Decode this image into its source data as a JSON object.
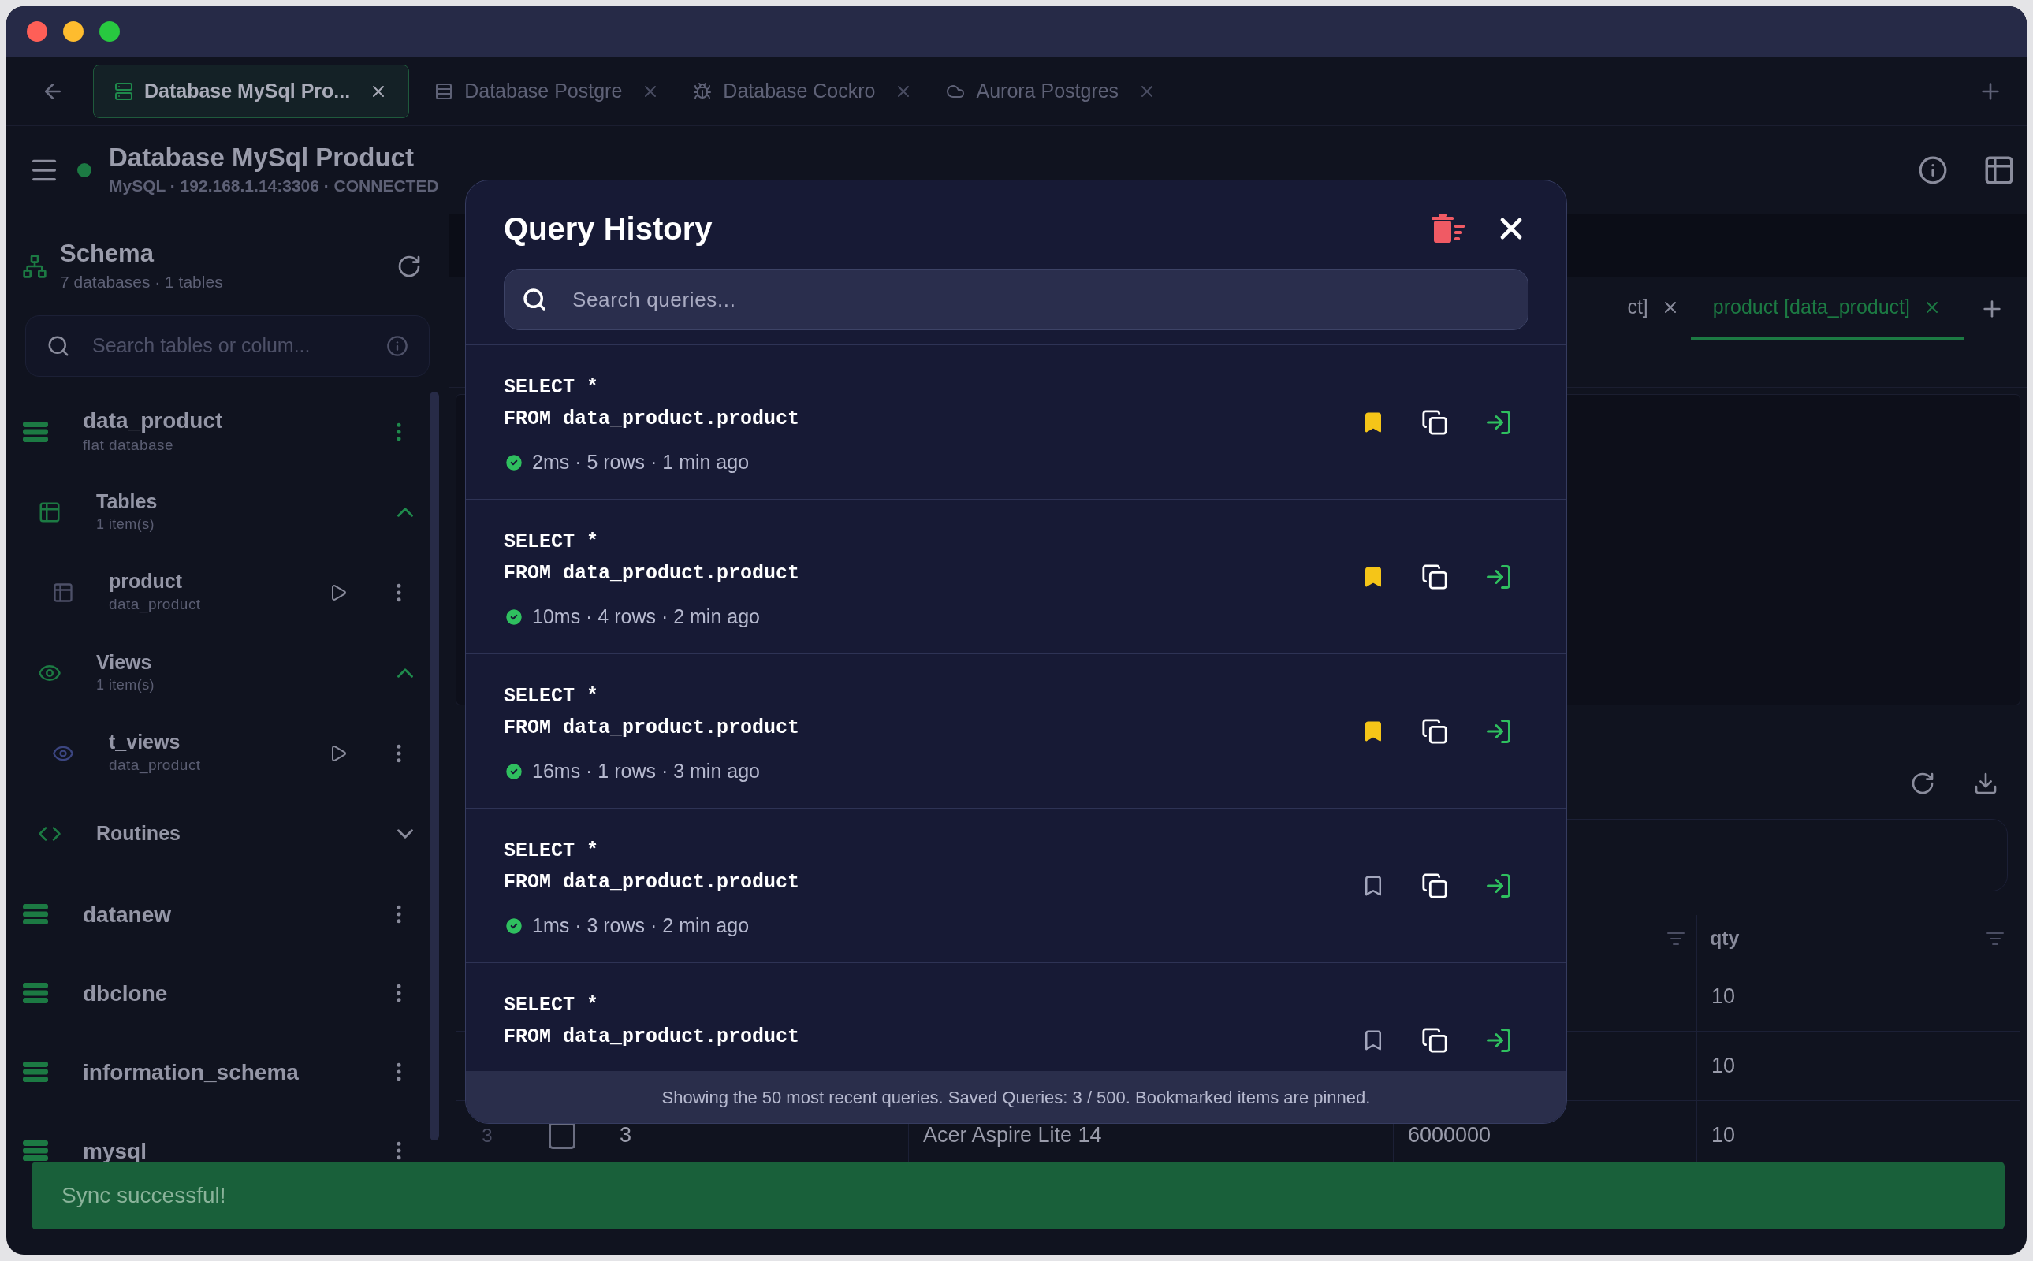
{
  "tabs": [
    {
      "label": "Database MySql Pro...",
      "kind": "server",
      "selected": true
    },
    {
      "label": "Database Postgre",
      "kind": "rows",
      "selected": false
    },
    {
      "label": "Database Cockro",
      "kind": "bug",
      "selected": false
    },
    {
      "label": "Aurora Postgres",
      "kind": "cloud",
      "selected": false
    }
  ],
  "connection": {
    "title": "Database MySql Product",
    "subtitle": "MySQL · 192.168.1.14:3306 · CONNECTED",
    "connected": true
  },
  "sidebar": {
    "title": "Schema",
    "subtitle": "7 databases · 1 tables",
    "search_placeholder": "Search tables or colum...",
    "databases": [
      {
        "name": "data_product",
        "note": "flat database",
        "active": true,
        "children": [
          {
            "kind": "tables",
            "name": "Tables",
            "count": "1 item(s)",
            "expanded": true,
            "children": [
              {
                "kind": "table",
                "name": "product",
                "schema": "data_product"
              }
            ]
          },
          {
            "kind": "views",
            "name": "Views",
            "count": "1 item(s)",
            "expanded": true,
            "children": [
              {
                "kind": "view",
                "name": "t_views",
                "schema": "data_product"
              }
            ]
          },
          {
            "kind": "routines",
            "name": "Routines",
            "expanded": false
          }
        ]
      },
      {
        "name": "datanew",
        "active": false
      },
      {
        "name": "dbclone",
        "active": false
      },
      {
        "name": "information_schema",
        "active": false
      },
      {
        "name": "mysql",
        "active": false
      }
    ]
  },
  "editor_tabs": [
    {
      "label": "ct]",
      "selected": false
    },
    {
      "label": "product [data_product]",
      "selected": true
    }
  ],
  "results": {
    "columns": [
      {},
      {},
      {},
      {},
      {
        "label": "qty"
      }
    ],
    "rows": [
      {
        "cells": [
          "",
          "",
          "",
          "",
          "10"
        ]
      },
      {
        "cells": [
          "",
          "",
          "",
          "",
          "10"
        ]
      },
      {
        "cells": [
          "3",
          "3",
          "Acer Aspire Lite 14",
          "6000000",
          "10"
        ],
        "checked": false
      }
    ]
  },
  "query_history": {
    "title": "Query History",
    "search_placeholder": "Search queries...",
    "items": [
      {
        "lines": [
          "SELECT *",
          "FROM data_product.product"
        ],
        "meta": "2ms · 5 rows · 1 min ago",
        "bookmarked": true
      },
      {
        "lines": [
          "SELECT *",
          "FROM data_product.product"
        ],
        "meta": "10ms · 4 rows · 2 min ago",
        "bookmarked": true
      },
      {
        "lines": [
          "SELECT *",
          "FROM data_product.product"
        ],
        "meta": "16ms · 1 rows · 3 min ago",
        "bookmarked": true
      },
      {
        "lines": [
          "SELECT *",
          "FROM data_product.product"
        ],
        "meta": "1ms · 3 rows · 2 min ago",
        "bookmarked": false
      },
      {
        "lines": [
          "SELECT *",
          "FROM data_product.product"
        ],
        "bookmarked": false
      }
    ],
    "footer": "Showing the 50 most recent queries. Saved Queries: 3 / 500. Bookmarked items are pinned."
  },
  "toast": {
    "message": "Sync successful!"
  }
}
